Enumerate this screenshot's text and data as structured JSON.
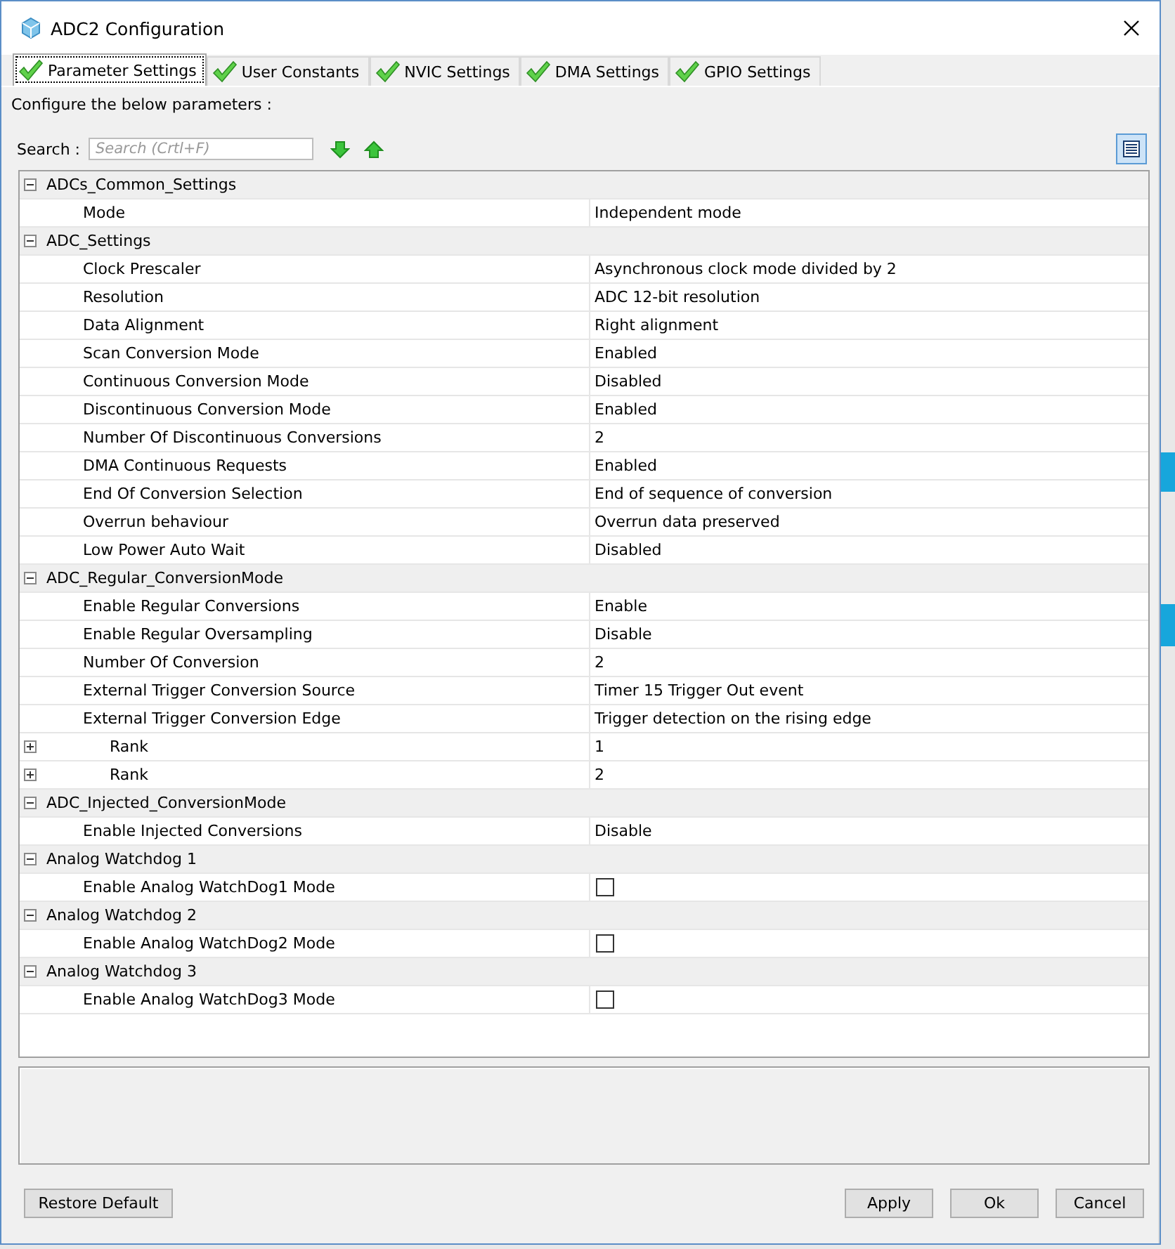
{
  "window": {
    "title": "ADC2 Configuration"
  },
  "tabs": [
    {
      "label": "Parameter Settings",
      "selected": true
    },
    {
      "label": "User Constants",
      "selected": false
    },
    {
      "label": "NVIC Settings",
      "selected": false
    },
    {
      "label": "DMA Settings",
      "selected": false
    },
    {
      "label": "GPIO Settings",
      "selected": false
    }
  ],
  "intro": "Configure the below parameters :",
  "search": {
    "label": "Search :",
    "placeholder": "Search (Crtl+F)"
  },
  "tree": [
    {
      "label": "ADCs_Common_Settings",
      "expanded": true,
      "children": [
        {
          "label": "Mode",
          "kind": "text",
          "value": "Independent mode"
        }
      ]
    },
    {
      "label": "ADC_Settings",
      "expanded": true,
      "children": [
        {
          "label": "Clock Prescaler",
          "kind": "text",
          "value": "Asynchronous clock mode divided by 2"
        },
        {
          "label": "Resolution",
          "kind": "text",
          "value": "ADC 12-bit resolution"
        },
        {
          "label": "Data Alignment",
          "kind": "text",
          "value": "Right alignment"
        },
        {
          "label": "Scan Conversion Mode",
          "kind": "text",
          "value": "Enabled"
        },
        {
          "label": "Continuous Conversion Mode",
          "kind": "text",
          "value": "Disabled"
        },
        {
          "label": "Discontinuous Conversion Mode",
          "kind": "text",
          "value": "Enabled"
        },
        {
          "label": "Number Of Discontinuous Conversions",
          "kind": "text",
          "value": "2"
        },
        {
          "label": "DMA Continuous Requests",
          "kind": "text",
          "value": "Enabled"
        },
        {
          "label": "End Of Conversion Selection",
          "kind": "text",
          "value": "End of sequence of conversion"
        },
        {
          "label": "Overrun behaviour",
          "kind": "text",
          "value": "Overrun data preserved"
        },
        {
          "label": "Low Power Auto Wait",
          "kind": "text",
          "value": "Disabled"
        }
      ]
    },
    {
      "label": "ADC_Regular_ConversionMode",
      "expanded": true,
      "children": [
        {
          "label": "Enable Regular Conversions",
          "kind": "text",
          "value": "Enable"
        },
        {
          "label": "Enable Regular Oversampling",
          "kind": "text",
          "value": "Disable"
        },
        {
          "label": "Number Of Conversion",
          "kind": "text",
          "value": "2"
        },
        {
          "label": "External Trigger Conversion Source",
          "kind": "text",
          "value": "Timer 15 Trigger Out event"
        },
        {
          "label": "External Trigger Conversion Edge",
          "kind": "text",
          "value": "Trigger detection on the rising edge"
        },
        {
          "label": "Rank",
          "kind": "text",
          "value": "1",
          "expanded": false
        },
        {
          "label": "Rank",
          "kind": "text",
          "value": "2",
          "expanded": false
        }
      ]
    },
    {
      "label": "ADC_Injected_ConversionMode",
      "expanded": true,
      "children": [
        {
          "label": "Enable Injected Conversions",
          "kind": "text",
          "value": "Disable"
        }
      ]
    },
    {
      "label": "Analog Watchdog 1",
      "expanded": true,
      "children": [
        {
          "label": "Enable Analog WatchDog1 Mode",
          "kind": "checkbox",
          "checked": false
        }
      ]
    },
    {
      "label": "Analog Watchdog 2",
      "expanded": true,
      "children": [
        {
          "label": "Enable Analog WatchDog2 Mode",
          "kind": "checkbox",
          "checked": false
        }
      ]
    },
    {
      "label": "Analog Watchdog 3",
      "expanded": true,
      "children": [
        {
          "label": "Enable Analog WatchDog3 Mode",
          "kind": "checkbox",
          "checked": false
        }
      ]
    }
  ],
  "buttons": {
    "left": [
      "Restore Default"
    ],
    "right": [
      "Apply",
      "Ok",
      "Cancel"
    ]
  }
}
